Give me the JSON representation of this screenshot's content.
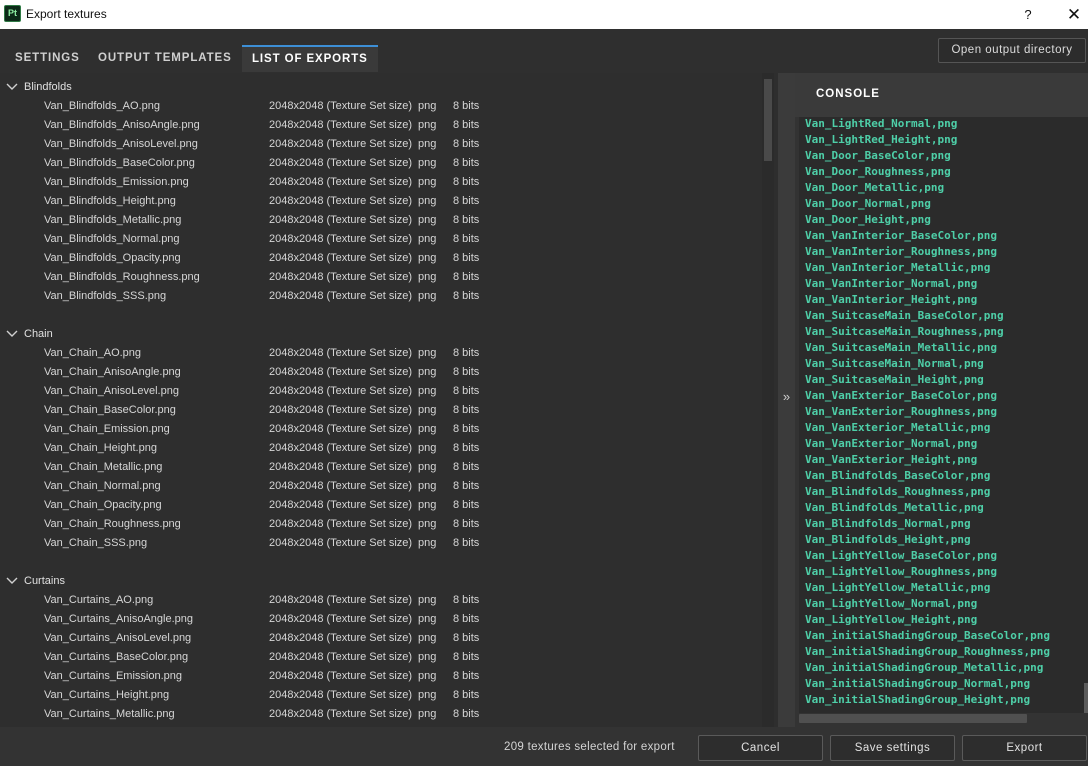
{
  "window": {
    "app_icon_text": "Pt",
    "title": "Export textures",
    "help_label": "?",
    "close_label": "✕"
  },
  "tabs": [
    {
      "label": "SETTINGS",
      "active": false
    },
    {
      "label": "OUTPUT TEMPLATES",
      "active": false
    },
    {
      "label": "LIST OF EXPORTS",
      "active": true
    }
  ],
  "open_output_label": "Open output directory",
  "groups": [
    {
      "name": "Blindfolds",
      "files": [
        {
          "name": "Van_Blindfolds_AO.png",
          "size": "2048x2048 (Texture Set size)",
          "format": "png",
          "bits": "8 bits"
        },
        {
          "name": "Van_Blindfolds_AnisoAngle.png",
          "size": "2048x2048 (Texture Set size)",
          "format": "png",
          "bits": "8 bits"
        },
        {
          "name": "Van_Blindfolds_AnisoLevel.png",
          "size": "2048x2048 (Texture Set size)",
          "format": "png",
          "bits": "8 bits"
        },
        {
          "name": "Van_Blindfolds_BaseColor.png",
          "size": "2048x2048 (Texture Set size)",
          "format": "png",
          "bits": "8 bits"
        },
        {
          "name": "Van_Blindfolds_Emission.png",
          "size": "2048x2048 (Texture Set size)",
          "format": "png",
          "bits": "8 bits"
        },
        {
          "name": "Van_Blindfolds_Height.png",
          "size": "2048x2048 (Texture Set size)",
          "format": "png",
          "bits": "8 bits"
        },
        {
          "name": "Van_Blindfolds_Metallic.png",
          "size": "2048x2048 (Texture Set size)",
          "format": "png",
          "bits": "8 bits"
        },
        {
          "name": "Van_Blindfolds_Normal.png",
          "size": "2048x2048 (Texture Set size)",
          "format": "png",
          "bits": "8 bits"
        },
        {
          "name": "Van_Blindfolds_Opacity.png",
          "size": "2048x2048 (Texture Set size)",
          "format": "png",
          "bits": "8 bits"
        },
        {
          "name": "Van_Blindfolds_Roughness.png",
          "size": "2048x2048 (Texture Set size)",
          "format": "png",
          "bits": "8 bits"
        },
        {
          "name": "Van_Blindfolds_SSS.png",
          "size": "2048x2048 (Texture Set size)",
          "format": "png",
          "bits": "8 bits"
        }
      ]
    },
    {
      "name": "Chain",
      "files": [
        {
          "name": "Van_Chain_AO.png",
          "size": "2048x2048 (Texture Set size)",
          "format": "png",
          "bits": "8 bits"
        },
        {
          "name": "Van_Chain_AnisoAngle.png",
          "size": "2048x2048 (Texture Set size)",
          "format": "png",
          "bits": "8 bits"
        },
        {
          "name": "Van_Chain_AnisoLevel.png",
          "size": "2048x2048 (Texture Set size)",
          "format": "png",
          "bits": "8 bits"
        },
        {
          "name": "Van_Chain_BaseColor.png",
          "size": "2048x2048 (Texture Set size)",
          "format": "png",
          "bits": "8 bits"
        },
        {
          "name": "Van_Chain_Emission.png",
          "size": "2048x2048 (Texture Set size)",
          "format": "png",
          "bits": "8 bits"
        },
        {
          "name": "Van_Chain_Height.png",
          "size": "2048x2048 (Texture Set size)",
          "format": "png",
          "bits": "8 bits"
        },
        {
          "name": "Van_Chain_Metallic.png",
          "size": "2048x2048 (Texture Set size)",
          "format": "png",
          "bits": "8 bits"
        },
        {
          "name": "Van_Chain_Normal.png",
          "size": "2048x2048 (Texture Set size)",
          "format": "png",
          "bits": "8 bits"
        },
        {
          "name": "Van_Chain_Opacity.png",
          "size": "2048x2048 (Texture Set size)",
          "format": "png",
          "bits": "8 bits"
        },
        {
          "name": "Van_Chain_Roughness.png",
          "size": "2048x2048 (Texture Set size)",
          "format": "png",
          "bits": "8 bits"
        },
        {
          "name": "Van_Chain_SSS.png",
          "size": "2048x2048 (Texture Set size)",
          "format": "png",
          "bits": "8 bits"
        }
      ]
    },
    {
      "name": "Curtains",
      "files": [
        {
          "name": "Van_Curtains_AO.png",
          "size": "2048x2048 (Texture Set size)",
          "format": "png",
          "bits": "8 bits"
        },
        {
          "name": "Van_Curtains_AnisoAngle.png",
          "size": "2048x2048 (Texture Set size)",
          "format": "png",
          "bits": "8 bits"
        },
        {
          "name": "Van_Curtains_AnisoLevel.png",
          "size": "2048x2048 (Texture Set size)",
          "format": "png",
          "bits": "8 bits"
        },
        {
          "name": "Van_Curtains_BaseColor.png",
          "size": "2048x2048 (Texture Set size)",
          "format": "png",
          "bits": "8 bits"
        },
        {
          "name": "Van_Curtains_Emission.png",
          "size": "2048x2048 (Texture Set size)",
          "format": "png",
          "bits": "8 bits"
        },
        {
          "name": "Van_Curtains_Height.png",
          "size": "2048x2048 (Texture Set size)",
          "format": "png",
          "bits": "8 bits"
        },
        {
          "name": "Van_Curtains_Metallic.png",
          "size": "2048x2048 (Texture Set size)",
          "format": "png",
          "bits": "8 bits"
        }
      ]
    }
  ],
  "console": {
    "title": "CONSOLE",
    "lines": [
      "Van_LightRed_Normal,png",
      "Van_LightRed_Height,png",
      "Van_Door_BaseColor,png",
      "Van_Door_Roughness,png",
      "Van_Door_Metallic,png",
      "Van_Door_Normal,png",
      "Van_Door_Height,png",
      "Van_VanInterior_BaseColor,png",
      "Van_VanInterior_Roughness,png",
      "Van_VanInterior_Metallic,png",
      "Van_VanInterior_Normal,png",
      "Van_VanInterior_Height,png",
      "Van_SuitcaseMain_BaseColor,png",
      "Van_SuitcaseMain_Roughness,png",
      "Van_SuitcaseMain_Metallic,png",
      "Van_SuitcaseMain_Normal,png",
      "Van_SuitcaseMain_Height,png",
      "Van_VanExterior_BaseColor,png",
      "Van_VanExterior_Roughness,png",
      "Van_VanExterior_Metallic,png",
      "Van_VanExterior_Normal,png",
      "Van_VanExterior_Height,png",
      "Van_Blindfolds_BaseColor,png",
      "Van_Blindfolds_Roughness,png",
      "Van_Blindfolds_Metallic,png",
      "Van_Blindfolds_Normal,png",
      "Van_Blindfolds_Height,png",
      "Van_LightYellow_BaseColor,png",
      "Van_LightYellow_Roughness,png",
      "Van_LightYellow_Metallic,png",
      "Van_LightYellow_Normal,png",
      "Van_LightYellow_Height,png",
      "Van_initialShadingGroup_BaseColor,png",
      "Van_initialShadingGroup_Roughness,png",
      "Van_initialShadingGroup_Metallic,png",
      "Van_initialShadingGroup_Normal,png",
      "Van_initialShadingGroup_Height,png"
    ]
  },
  "footer": {
    "status": "209 textures selected for export",
    "cancel_label": "Cancel",
    "save_label": "Save settings",
    "export_label": "Export"
  },
  "splitter_icon": "»",
  "colors": {
    "console_text": "#4ecfa8",
    "active_tab_accent": "#3d8fd6"
  }
}
